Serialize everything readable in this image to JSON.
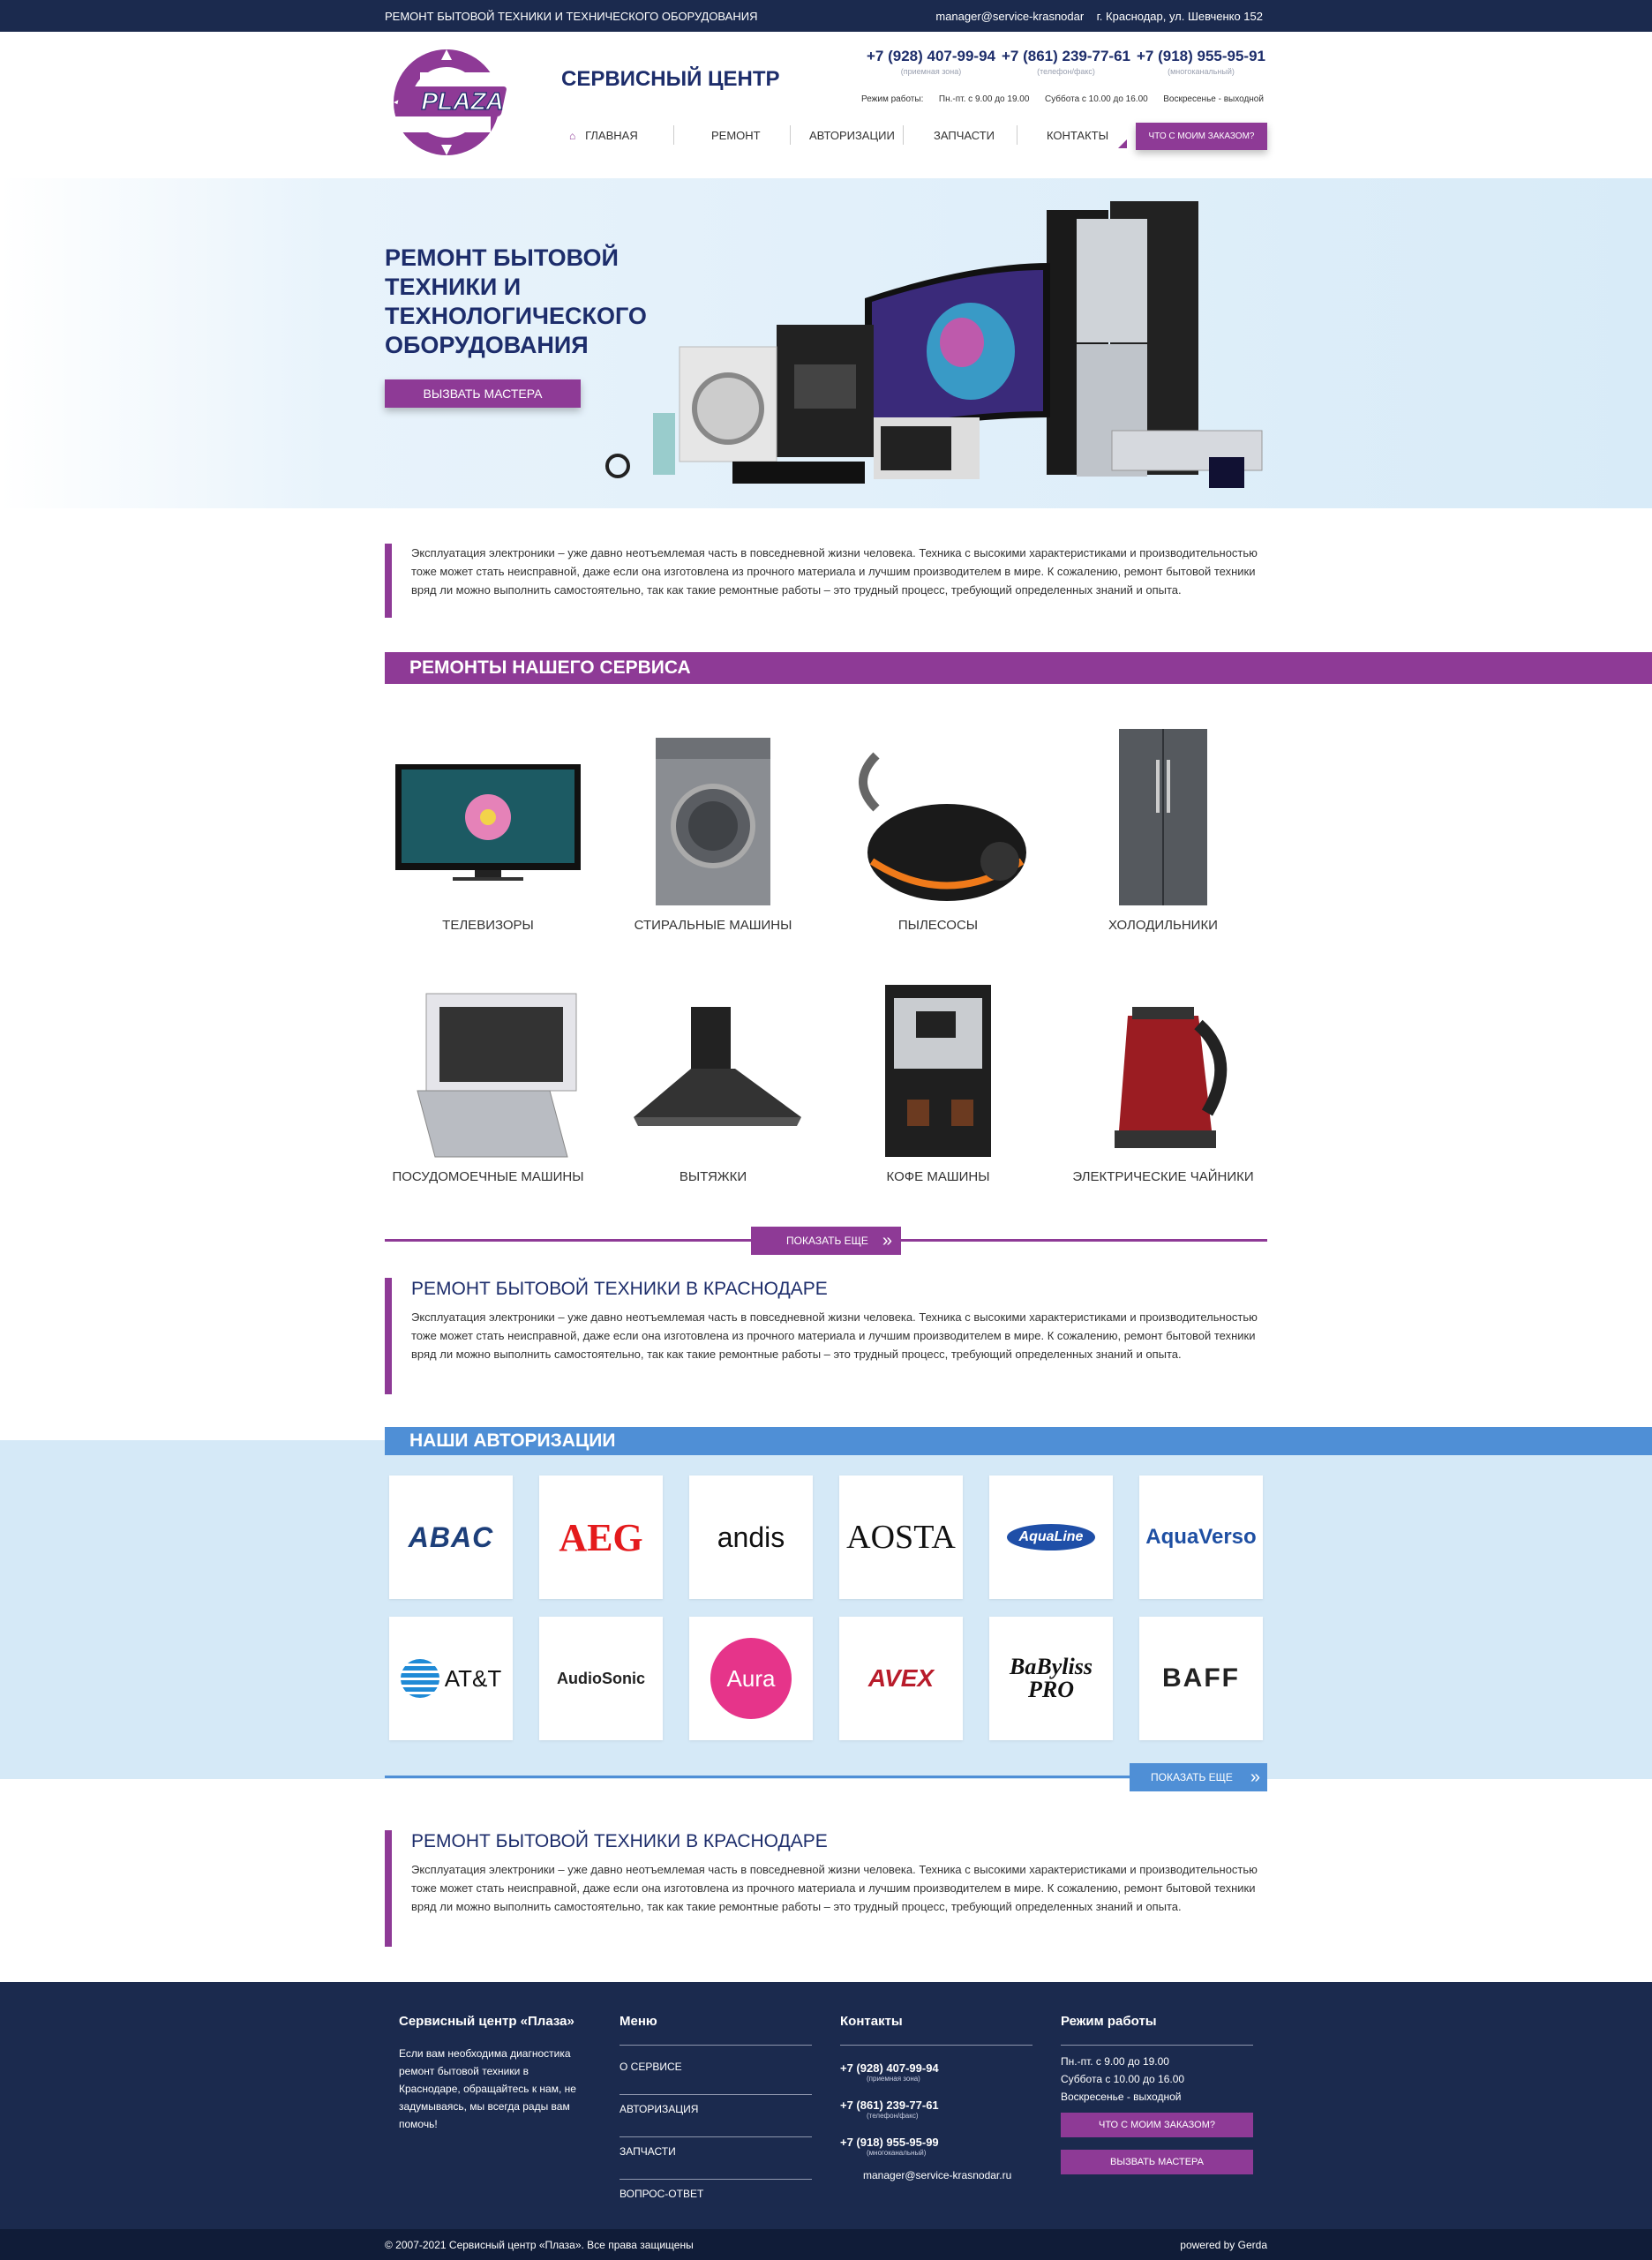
{
  "topbar": {
    "title": "РЕМОНТ БЫТОВОЙ ТЕХНИКИ И ТЕХНИЧЕСКОГО ОБОРУДОВАНИЯ",
    "email": "manager@service-krasnodar",
    "address": "г. Краснодар, ул. Шевченко 152"
  },
  "header": {
    "logo_text": "PLAZA",
    "brand": "СЕРВИСНЫЙ ЦЕНТР",
    "phones": [
      {
        "number": "+7 (928) 407-99-94",
        "note": "(приемная зона)"
      },
      {
        "number": "+7 (861) 239-77-61",
        "note": "(телефон/факс)"
      },
      {
        "number": "+7 (918) 955-95-91",
        "note": "(многоканальный)"
      }
    ],
    "hours_label": "Режим работы:",
    "hours": [
      "Пн.-пт. с 9.00 до 19.00",
      "Суббота с 10.00 до 16.00",
      "Воскресенье - выходной"
    ],
    "nav": [
      "ГЛАВНАЯ",
      "РЕМОНТ",
      "АВТОРИЗАЦИИ",
      "ЗАПЧАСТИ",
      "КОНТАКТЫ"
    ],
    "order_button": "ЧТО С МОИМ ЗАКАЗОМ?"
  },
  "hero": {
    "title": "РЕМОНТ БЫТОВОЙ ТЕХНИКИ И ТЕХНОЛОГИЧЕСКОГО ОБОРУДОВАНИЯ",
    "button": "ВЫЗВАТЬ МАСТЕРА"
  },
  "intro": {
    "text": "Эксплуатация электроники – уже давно неотъемлемая часть в повседневной жизни человека. Техника с высокими характеристиками и производительностью тоже может стать неисправной, даже если она изготовлена из прочного материала и лучшим производителем в мире. К сожалению, ремонт бытовой техники вряд ли можно выполнить самостоятельно, так как такие ремонтные работы – это трудный процесс, требующий определенных знаний и опыта."
  },
  "services": {
    "heading": "РЕМОНТЫ НАШЕГО СЕРВИСА",
    "items": [
      "ТЕЛЕВИЗОРЫ",
      "СТИРАЛЬНЫЕ МАШИНЫ",
      "ПЫЛЕСОСЫ",
      "ХОЛОДИЛЬНИКИ",
      "ПОСУДОМОЕЧНЫЕ МАШИНЫ",
      "ВЫТЯЖКИ",
      "КОФЕ МАШИНЫ",
      "ЭЛЕКТРИЧЕСКИЕ ЧАЙНИКИ"
    ],
    "more": "ПОКАЗАТЬ ЕЩЕ"
  },
  "about1": {
    "title": "РЕМОНТ БЫТОВОЙ ТЕХНИКИ В КРАСНОДАРЕ",
    "text": "Эксплуатация электроники – уже давно неотъемлемая часть в повседневной жизни человека. Техника с высокими характеристиками и производительностью тоже может стать неисправной, даже если она изготовлена из прочного материала и лучшим производителем в мире. К сожалению, ремонт бытовой техники вряд ли можно выполнить самостоятельно, так как такие ремонтные работы – это трудный процесс, требующий определенных знаний и опыта."
  },
  "authorizations": {
    "heading": "НАШИ АВТОРИЗАЦИИ",
    "brands": [
      "ABAC",
      "AEG",
      "andis",
      "AOSTA",
      "AquaLine",
      "AquaVerso",
      "AT&T",
      "AudioSonic",
      "Aura",
      "AVEX",
      "BaByliss PRO",
      "BAFF"
    ],
    "more": "ПОКАЗАТЬ ЕЩЕ"
  },
  "about2": {
    "title": "РЕМОНТ БЫТОВОЙ ТЕХНИКИ В КРАСНОДАРЕ",
    "text": "Эксплуатация электроники – уже давно неотъемлемая часть в повседневной жизни человека. Техника с высокими характеристиками и производительностью тоже может стать неисправной, даже если она изготовлена из прочного материала и лучшим производителем в мире. К сожалению, ремонт бытовой техники вряд ли можно выполнить самостоятельно, так как такие ремонтные работы – это трудный процесс, требующий определенных знаний и опыта."
  },
  "footer": {
    "about_title": "Сервисный центр «Плаза»",
    "about_text": "Если вам необходима диагностика ремонт бытовой техники в Краснодаре, обращайтесь к нам, не задумываясь, мы всегда рады вам помочь!",
    "menu_title": "Меню",
    "menu": [
      "О СЕРВИСЕ",
      "АВТОРИЗАЦИЯ",
      "ЗАПЧАСТИ",
      "ВОПРОС-ОТВЕТ"
    ],
    "contacts_title": "Контакты",
    "phones": [
      {
        "number": "+7 (928) 407-99-94",
        "note": "(приемная зона)"
      },
      {
        "number": "+7 (861) 239-77-61",
        "note": "(телефон/факс)"
      },
      {
        "number": "+7 (918) 955-95-99",
        "note": "(многоканальный)"
      }
    ],
    "email": "manager@service-krasnodar.ru",
    "hours_title": "Режим работы",
    "hours": [
      "Пн.-пт. с 9.00 до 19.00",
      "Суббота с 10.00 до 16.00",
      "Воскресенье - выходной"
    ],
    "order_button": "ЧТО С МОИМ ЗАКАЗОМ?",
    "call_button": "ВЫЗВАТЬ МАСТЕРА"
  },
  "bottom": {
    "copyright": "© 2007-2021 Сервисный центр «Плаза». Все права защищены",
    "powered": "powered by Gerda"
  },
  "colors": {
    "navy": "#1b2a4e",
    "purple": "#8e3a96",
    "blue": "#4f8fd6",
    "light_blue": "#d5e9f7"
  }
}
